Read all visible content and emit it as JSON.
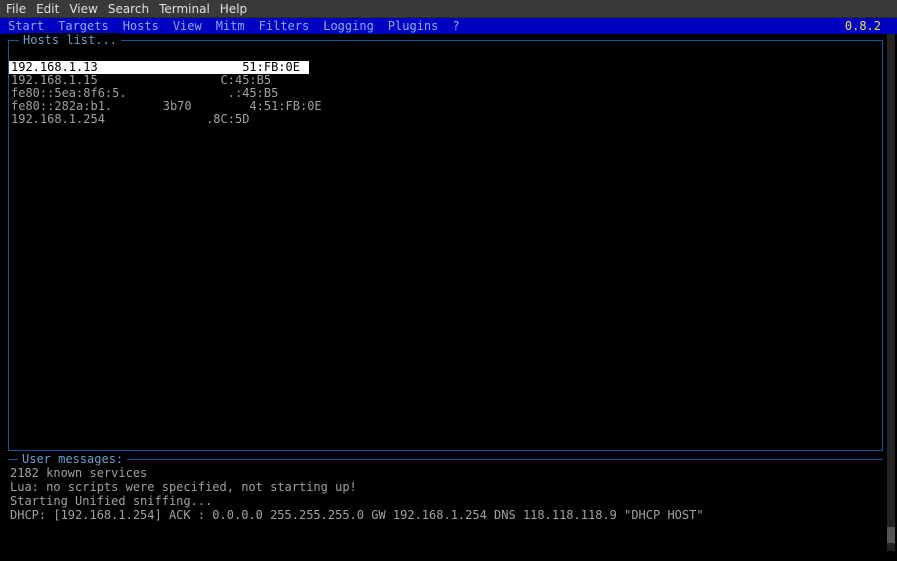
{
  "titlebar": {
    "items": [
      "File",
      "Edit",
      "View",
      "Search",
      "Terminal",
      "Help"
    ]
  },
  "menubar": {
    "items": [
      "Start",
      "Targets",
      "Hosts",
      "View",
      "Mitm",
      "Filters",
      "Logging",
      "Plugins",
      "?"
    ],
    "version": "0.8.2"
  },
  "hosts_panel": {
    "title": "Hosts list...",
    "rows": [
      {
        "text": "192.168.1.13                    51:FB:0E",
        "selected": true
      },
      {
        "text": "192.168.1.15                 C:45:B5",
        "selected": false
      },
      {
        "text": "fe80::5ea:8f6:5.              .:45:B5",
        "selected": false
      },
      {
        "text": "fe80::282a:b1.       3b70        4:51:FB:0E",
        "selected": false
      },
      {
        "text": "192.168.1.254              .8C:5D",
        "selected": false
      }
    ]
  },
  "messages_panel": {
    "title": "User messages:",
    "lines": [
      "2182 known services",
      "Lua: no scripts were specified, not starting up!",
      "Starting Unified sniffing...",
      "",
      "DHCP: [192.168.1.254] ACK : 0.0.0.0 255.255.255.0 GW 192.168.1.254 DNS 118.118.118.9 \"DHCP HOST\""
    ]
  }
}
